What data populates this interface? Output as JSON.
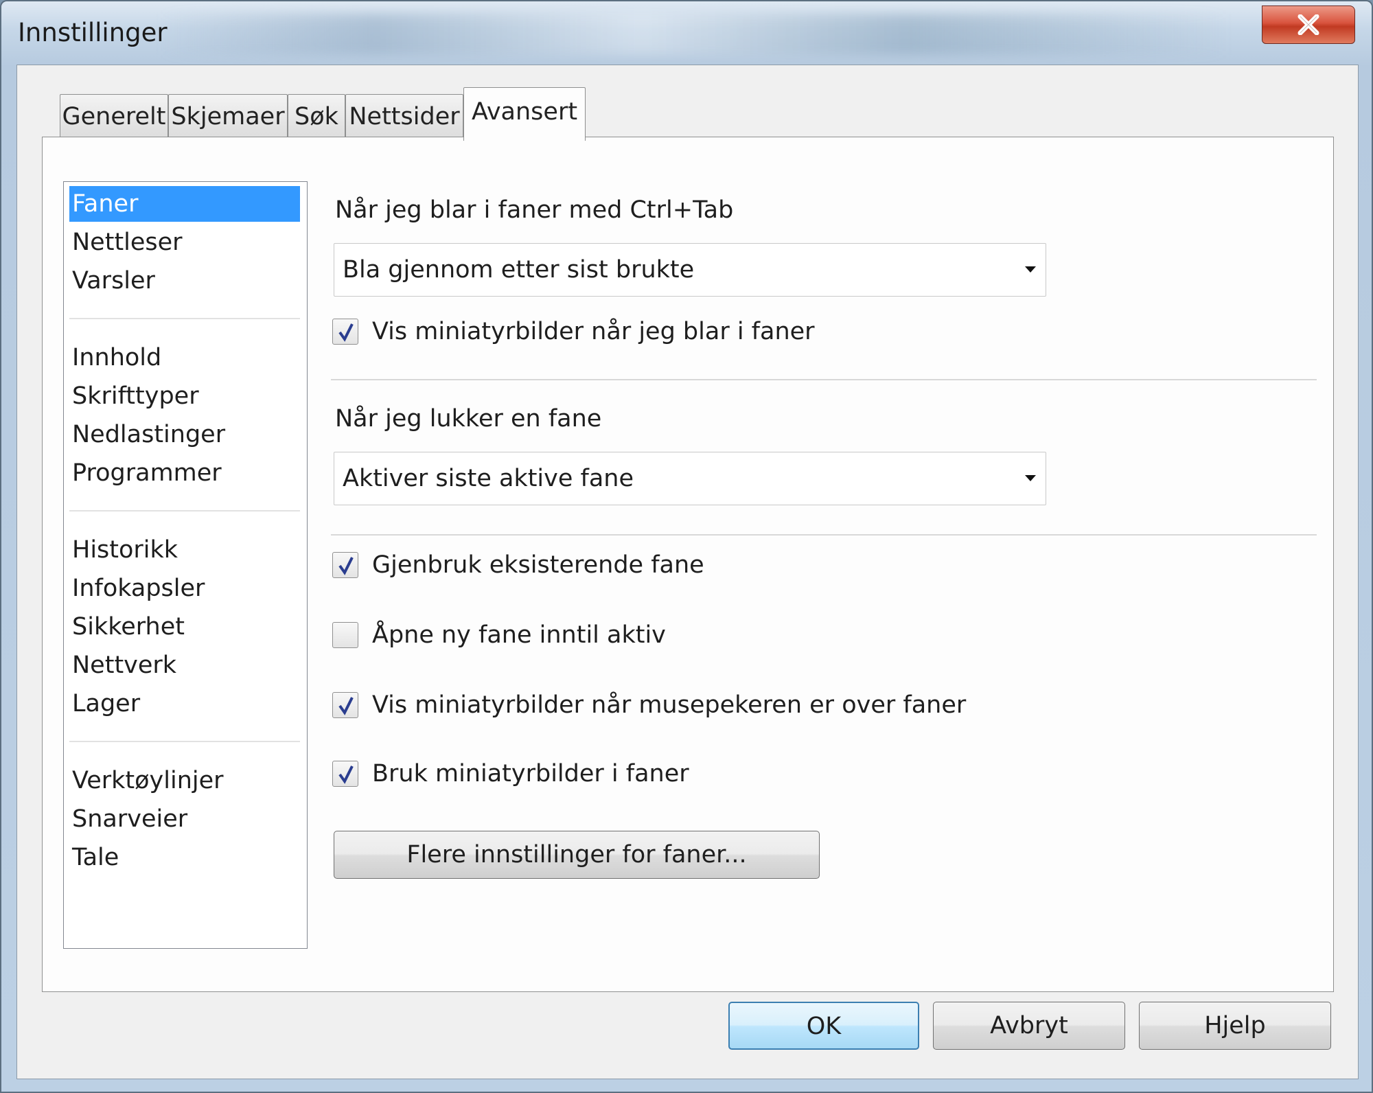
{
  "window": {
    "title": "Innstillinger"
  },
  "tabs": [
    {
      "label": "Generelt"
    },
    {
      "label": "Skjemaer"
    },
    {
      "label": "Søk"
    },
    {
      "label": "Nettsider"
    },
    {
      "label": "Avansert",
      "active": true
    }
  ],
  "sidebar": {
    "items": [
      {
        "label": "Faner",
        "selected": true
      },
      {
        "label": "Nettleser"
      },
      {
        "label": "Varsler"
      },
      {
        "label": "Innhold"
      },
      {
        "label": "Skrifttyper"
      },
      {
        "label": "Nedlastinger"
      },
      {
        "label": "Programmer"
      },
      {
        "label": "Historikk"
      },
      {
        "label": "Infokapsler"
      },
      {
        "label": "Sikkerhet"
      },
      {
        "label": "Nettverk"
      },
      {
        "label": "Lager"
      },
      {
        "label": "Verktøylinjer"
      },
      {
        "label": "Snarveier"
      },
      {
        "label": "Tale"
      }
    ]
  },
  "content": {
    "ctrl_tab_heading": "Når jeg blar i faner med Ctrl+Tab",
    "ctrl_tab_select": "Bla gjennom etter sist brukte",
    "show_thumbs_cycle": {
      "label": "Vis miniatyrbilder når jeg blar i faner",
      "checked": true
    },
    "close_heading": "Når jeg lukker en fane",
    "close_select": "Aktiver siste aktive fane",
    "reuse_tab": {
      "label": "Gjenbruk eksisterende fane",
      "checked": true
    },
    "open_next_to_active": {
      "label": "Åpne ny fane inntil aktiv",
      "checked": false
    },
    "hover_thumbs": {
      "label": "Vis miniatyrbilder når musepekeren er over faner",
      "checked": true
    },
    "tab_thumbs": {
      "label": "Bruk miniatyrbilder i faner",
      "checked": true
    },
    "more_button": "Flere innstillinger for faner..."
  },
  "footer": {
    "ok": "OK",
    "cancel": "Avbryt",
    "help": "Hjelp"
  },
  "colors": {
    "selection": "#3399ff",
    "close_button": "#c94a33",
    "default_button_border": "#3c7fb1"
  }
}
